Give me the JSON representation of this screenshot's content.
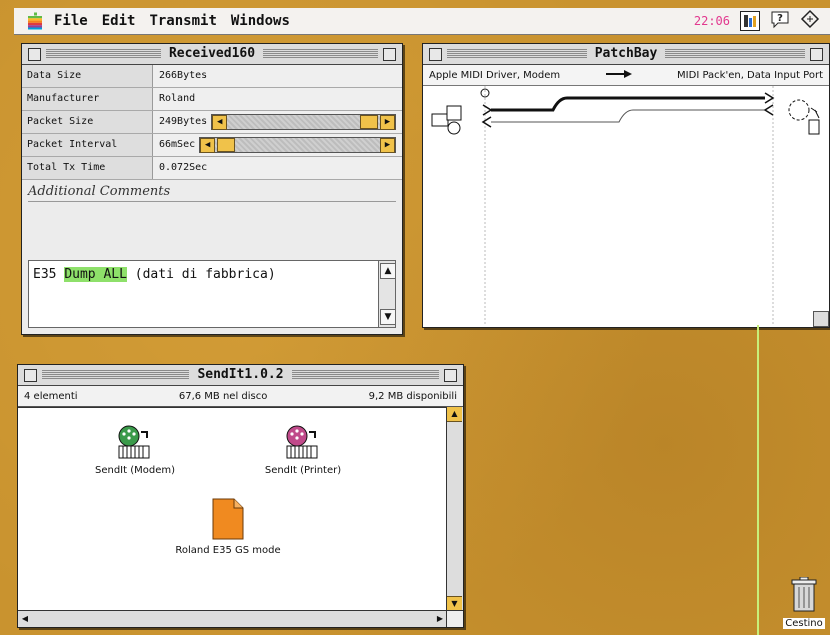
{
  "menubar": {
    "items": [
      "File",
      "Edit",
      "Transmit",
      "Windows"
    ],
    "clock": "22:06"
  },
  "received": {
    "title": "Received160",
    "rows": [
      {
        "label": "Data Size",
        "value": "266Bytes"
      },
      {
        "label": "Manufacturer",
        "value": "Roland"
      },
      {
        "label": "Packet Size",
        "value": "249Bytes"
      },
      {
        "label": "Packet Interval",
        "value": "66mSec"
      },
      {
        "label": "Total Tx Time",
        "value": "0.072Sec"
      }
    ],
    "comments_label": "Additional Comments",
    "comments_pre": "E35 ",
    "comments_highlight": "Dump ALL",
    "comments_post": " (dati di fabbrica)"
  },
  "patchbay": {
    "title": "PatchBay",
    "source": "Apple MIDI Driver, Modem",
    "destination": "MIDI Pack'en, Data Input Port"
  },
  "sendit": {
    "title": "SendIt1.0.2",
    "items_count": "4 elementi",
    "disk_used": "67,6 MB nel disco",
    "disk_free": "9,2 MB disponibili",
    "files": [
      {
        "label": "SendIt (Modem)",
        "icon": "midi-modem-icon",
        "color": "#3a9a4a"
      },
      {
        "label": "SendIt (Printer)",
        "icon": "midi-printer-icon",
        "color": "#c04a8a"
      },
      {
        "label": "Roland E35 GS mode",
        "icon": "document-icon",
        "color": "#f08a20"
      }
    ]
  },
  "trash": {
    "label": "Cestino"
  },
  "colors": {
    "desktop": "#c9932f",
    "highlight": "#8ee06a",
    "scroll_accent": "#f0c24a"
  }
}
